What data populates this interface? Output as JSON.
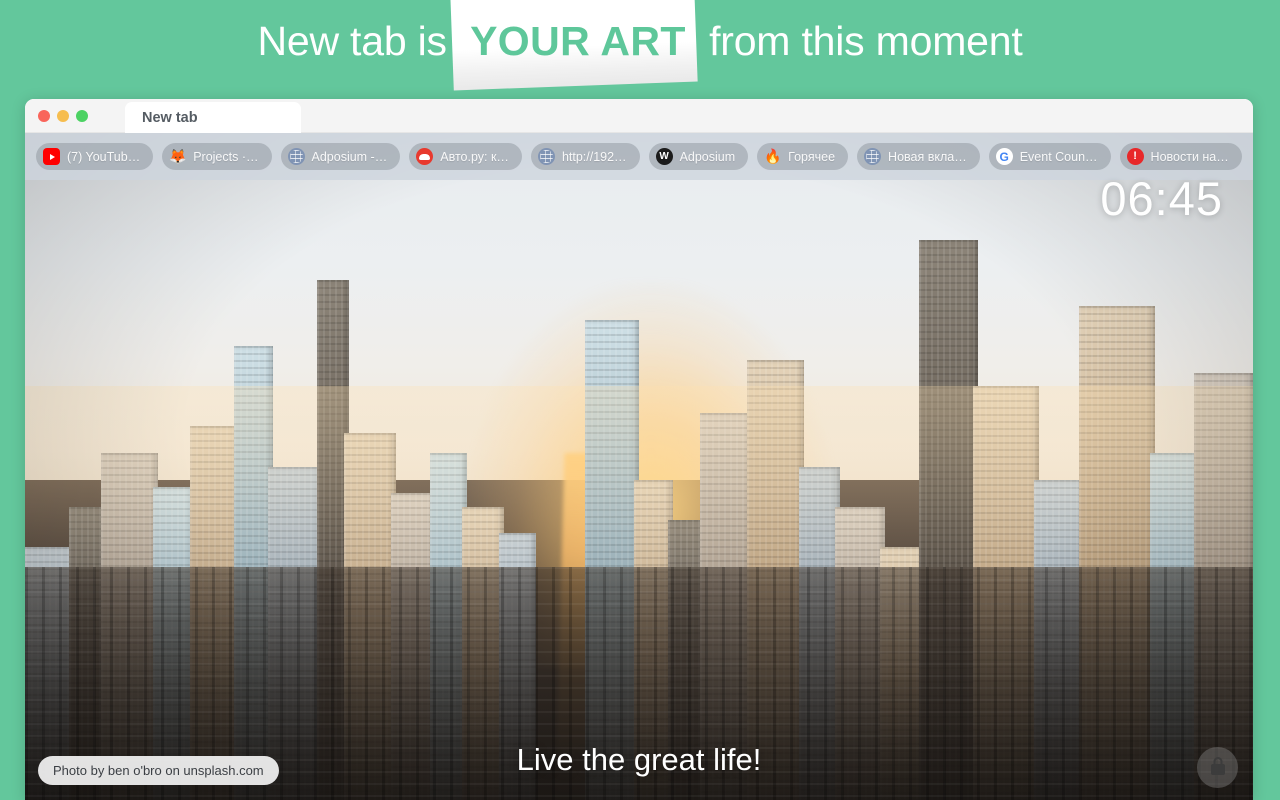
{
  "promo": {
    "before": "New tab is",
    "highlight": "YOUR ART",
    "after": "from this moment"
  },
  "browser": {
    "tab_title": "New tab",
    "traffic_lights": [
      "close-red",
      "minimize-yellow",
      "zoom-green"
    ]
  },
  "bookmarks": [
    {
      "label": "(7) YouTub…",
      "icon": "youtube-icon",
      "icon_class": "youtube",
      "glyph": ""
    },
    {
      "label": "Projects ·…",
      "icon": "gitlab-icon",
      "icon_class": "gitlab",
      "glyph": "🦊"
    },
    {
      "label": "Adposium -…",
      "icon": "globe-icon",
      "icon_class": "globe",
      "glyph": ""
    },
    {
      "label": "Авто.ру: к…",
      "icon": "car-icon",
      "icon_class": "auto",
      "glyph": ""
    },
    {
      "label": "http://192…",
      "icon": "globe-icon",
      "icon_class": "globe",
      "glyph": ""
    },
    {
      "label": "Adposium",
      "icon": "w-logo-icon",
      "icon_class": "wdark",
      "glyph": "W"
    },
    {
      "label": "Горячее",
      "icon": "flame-icon",
      "icon_class": "fire",
      "glyph": "🔥"
    },
    {
      "label": "Новая вкла…",
      "icon": "globe-icon",
      "icon_class": "globe",
      "glyph": ""
    },
    {
      "label": "Event Coun…",
      "icon": "google-icon",
      "icon_class": "google",
      "glyph": "G"
    },
    {
      "label": "Новости на…",
      "icon": "alert-icon",
      "icon_class": "excl",
      "glyph": ""
    }
  ],
  "newtab": {
    "clock": "06:45",
    "tagline": "Live the great life!",
    "photo_credit": "Photo by ben o'bro on unsplash.com",
    "lock_icon": "lock-icon"
  },
  "colors": {
    "brand_green": "#63c79c",
    "slab_white": "#ffffff",
    "highlight_text": "#5ec79a",
    "bookmark_bar": "#cdd4dd"
  }
}
